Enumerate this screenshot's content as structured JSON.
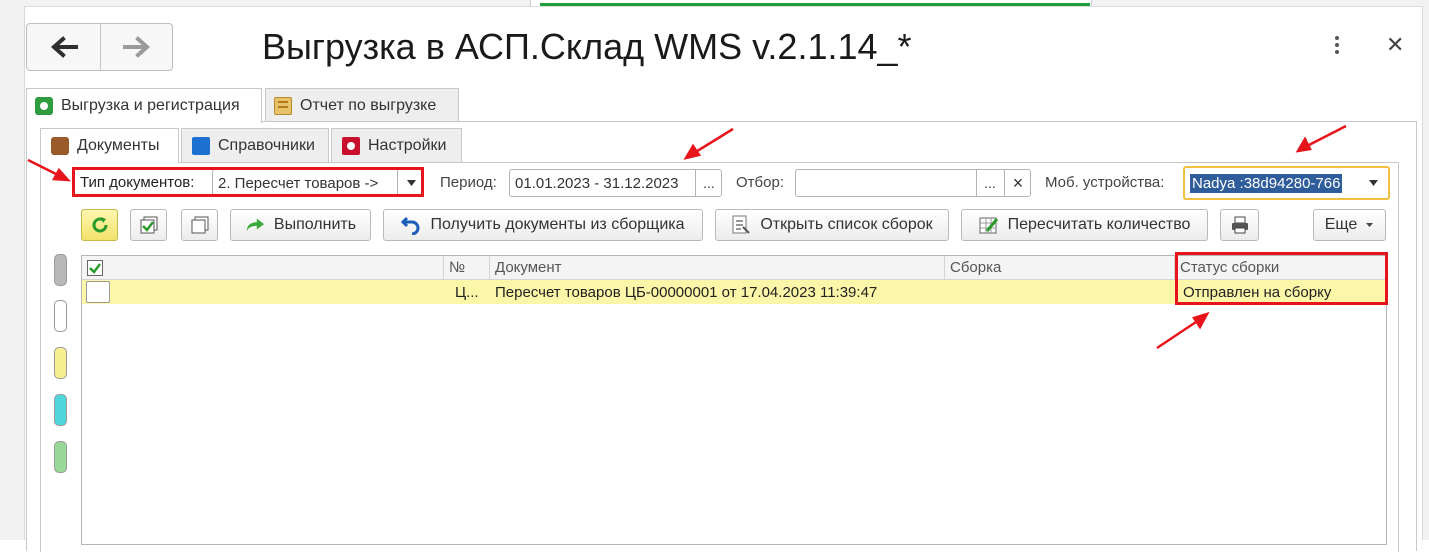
{
  "window": {
    "title": "Выгрузка в АСП.Склад WMS v.2.1.14_*",
    "back_icon": "arrow-left-icon",
    "forward_icon": "arrow-right-icon",
    "menu_icon": "kebab-menu-icon",
    "close_icon": "close-icon",
    "close_glyph": "✕"
  },
  "outer_tabs": [
    {
      "label": "Выгрузка и регистрация",
      "active": true,
      "icon": "upload-icon"
    },
    {
      "label": "Отчет по выгрузке",
      "active": false,
      "icon": "report-icon"
    }
  ],
  "inner_tabs": [
    {
      "label": "Документы",
      "active": true,
      "icon": "briefcase-icon"
    },
    {
      "label": "Справочники",
      "active": false,
      "icon": "book-icon"
    },
    {
      "label": "Настройки",
      "active": false,
      "icon": "settings-icon"
    }
  ],
  "filters": {
    "doc_type_label": "Тип документов:",
    "doc_type_value": "2. Пересчет товаров ->",
    "period_label": "Период:",
    "period_value": "01.01.2023 - 31.12.2023",
    "select_button": "...",
    "filter_label": "Отбор:",
    "filter_value": "",
    "clear_glyph": "×",
    "devices_label": "Моб. устройства:",
    "devices_value": "Nadya :38d94280-766"
  },
  "toolbar": {
    "refresh_icon": "refresh-icon",
    "check_all_icon": "check-all-icon",
    "uncheck_all_icon": "uncheck-all-icon",
    "execute_label": "Выполнить",
    "get_docs_label": "Получить документы из сборщика",
    "open_list_label": "Открыть список сборок",
    "recalc_label": "Пересчитать количество",
    "print_icon": "print-icon",
    "more_label": "Еще"
  },
  "table": {
    "columns": [
      "№",
      "Документ",
      "Сборка",
      "Статус сборки"
    ],
    "rows": [
      {
        "checked": false,
        "number": "Ц...",
        "document": "Пересчет товаров ЦБ-00000001 от 17.04.2023 11:39:47",
        "assembly": "",
        "status": "Отправлен на сборку"
      }
    ]
  },
  "markers": [
    "gray",
    "white",
    "yellow",
    "cyan",
    "green"
  ],
  "colors": {
    "highlight_red": "#e8141b",
    "row_yellow": "#fbf6a8",
    "device_border": "#f0c040",
    "device_selection": "#2f5c9a"
  }
}
